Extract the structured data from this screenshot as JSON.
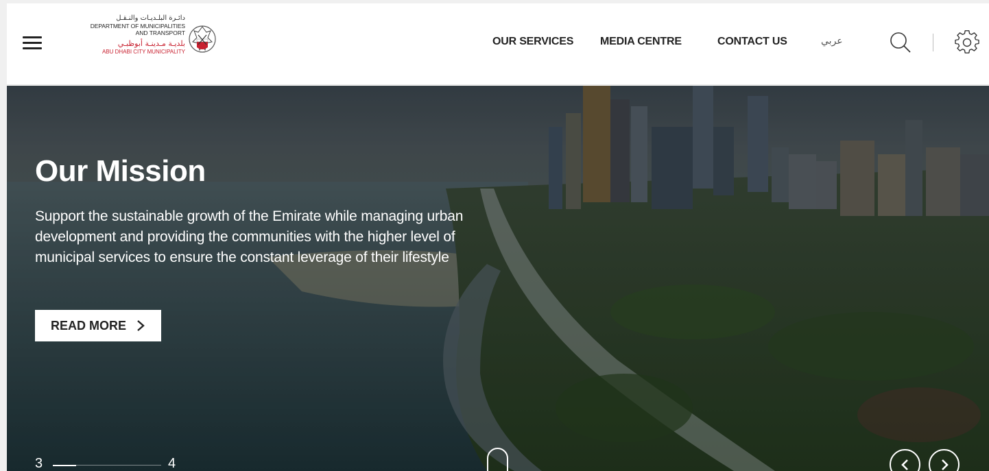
{
  "header": {
    "logo": {
      "arabic_line1": "دائـرة البلـديـات والنـقـل",
      "english_line1": "DEPARTMENT OF MUNICIPALITIES",
      "english_line2": "AND TRANSPORT",
      "arabic_line2": "بلديـة مـدينـة أبوظبـي",
      "english_line3": "ABU DHABI CITY MUNICIPALITY"
    },
    "nav": [
      {
        "label": "OUR SERVICES"
      },
      {
        "label": "MEDIA CENTRE"
      },
      {
        "label": "CONTACT US"
      }
    ],
    "language_label": "عربي",
    "icons": {
      "menu": "hamburger-menu-icon",
      "search": "search-icon",
      "settings": "gear-icon"
    }
  },
  "hero": {
    "title": "Our Mission",
    "description": "Support the sustainable growth of the Emirate while managing urban development and providing the communities with the higher level of municipal services to ensure the constant leverage of their lifestyle",
    "cta_label": "READ MORE",
    "slider": {
      "current": "3",
      "next": "4"
    }
  },
  "colors": {
    "brand_red": "#c8202f",
    "text_dark": "#222222",
    "white": "#ffffff"
  }
}
